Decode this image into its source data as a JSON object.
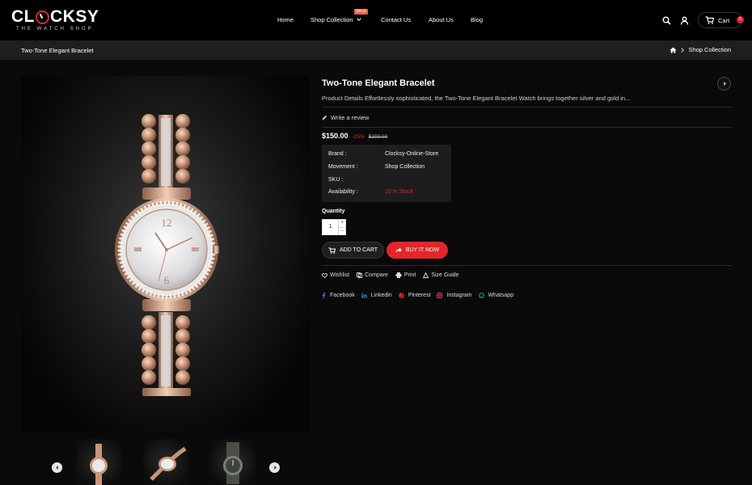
{
  "brand": {
    "logo_text_left": "CL",
    "logo_text_right": "CKSY",
    "tagline": "THE WATCH SHOP",
    "accent": "#e3262b"
  },
  "nav": {
    "items": [
      {
        "label": "Home"
      },
      {
        "label": "Shop Collection",
        "badge": "SALE"
      },
      {
        "label": "Contact Us"
      },
      {
        "label": "About Us"
      },
      {
        "label": "Blog"
      }
    ]
  },
  "header": {
    "cart_label": "Cart",
    "cart_count": "0",
    "icons": [
      "search-icon",
      "user-icon",
      "cart-icon"
    ]
  },
  "breadcrumb": {
    "page_title": "Two-Tone Elegant Bracelet",
    "trail": "Shop Collection"
  },
  "product": {
    "title": "Two-Tone Elegant Bracelet",
    "description": "Product Details Effortlessly sophisticated, the Two-Tone Elegant Bracelet Watch brings together silver and gold in...",
    "review_label": "Write a review",
    "price": "$150.00",
    "discount": "-25%",
    "old_price": "$200.00",
    "meta": [
      {
        "key": "Brand :",
        "value": "Clocksy-Online-Store"
      },
      {
        "key": "Movement :",
        "value": "Shop Collection"
      },
      {
        "key": "SKU :",
        "value": ""
      },
      {
        "key": "Availability :",
        "value": "20 In Stock"
      }
    ],
    "quantity_label": "Quantity",
    "quantity": "1",
    "add_to_cart": "ADD TO CART",
    "buy_now": "BUY IT NOW",
    "actions": [
      "Wishlist",
      "Compare",
      "Print",
      "Size Guide"
    ],
    "social": [
      "Facebook",
      "Linkedin",
      "Pinterest",
      "Instagram",
      "Whatsapp"
    ]
  }
}
